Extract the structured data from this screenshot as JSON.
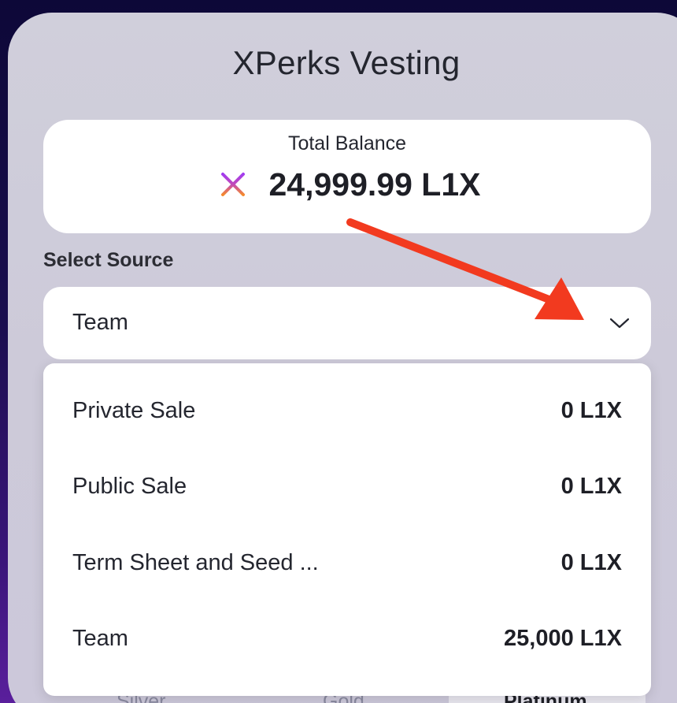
{
  "header": {
    "title": "XPerks Vesting"
  },
  "balance": {
    "label": "Total Balance",
    "value": "24,999.99 L1X",
    "icon": "l1x-logo-icon"
  },
  "source": {
    "label": "Select Source",
    "selected": "Team",
    "options": [
      {
        "label": "Private Sale",
        "amount": "0 L1X"
      },
      {
        "label": "Public Sale",
        "amount": "0 L1X"
      },
      {
        "label": "Term Sheet and Seed ...",
        "amount": "0 L1X"
      },
      {
        "label": "Team",
        "amount": "25,000 L1X"
      }
    ]
  },
  "tiers": {
    "items": [
      "Silver",
      "Gold",
      "Platinum"
    ],
    "active": "Platinum"
  },
  "colors": {
    "annotation_arrow": "#f23a1f",
    "background_top": "#0d0838",
    "background_bottom": "#5a1f9c",
    "panel": "#cfcdda"
  }
}
